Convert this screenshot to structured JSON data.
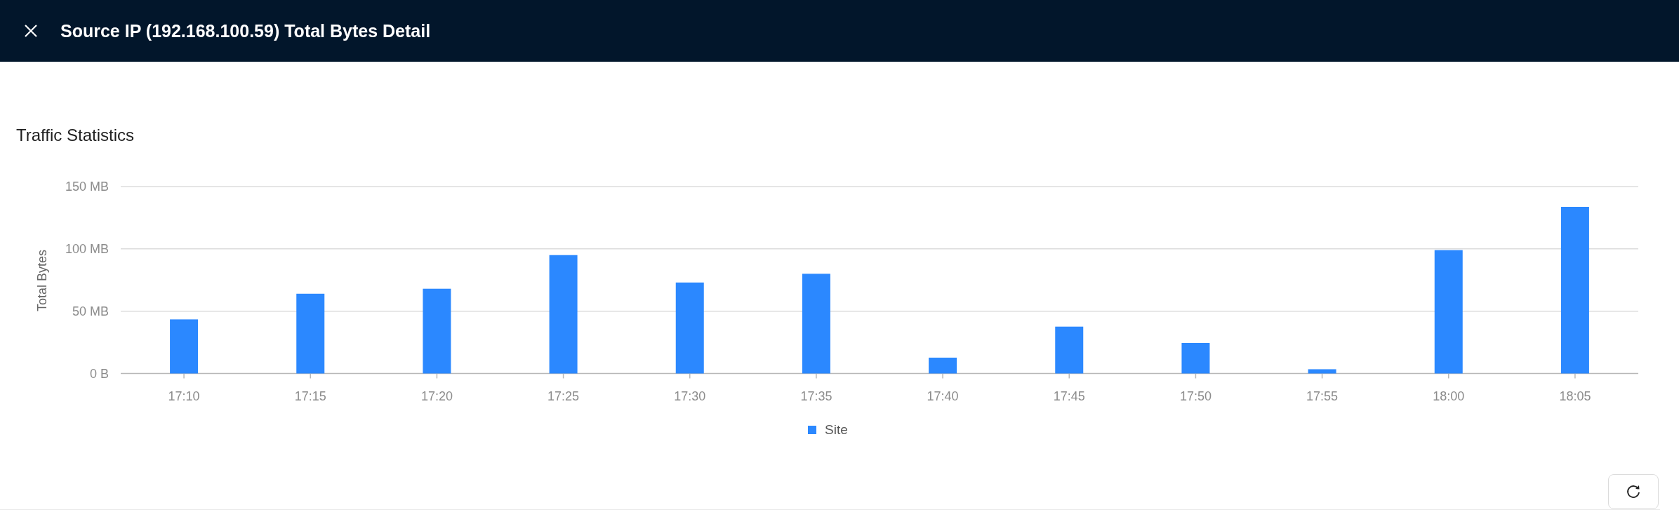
{
  "header": {
    "title": "Source IP (192.168.100.59) Total Bytes Detail"
  },
  "section_title": "Traffic Statistics",
  "chart_data": {
    "type": "bar",
    "ylabel": "Total Bytes",
    "categories": [
      "17:10",
      "17:15",
      "17:20",
      "17:25",
      "17:30",
      "17:35",
      "17:40",
      "17:45",
      "17:50",
      "17:55",
      "18:00",
      "18:05"
    ],
    "series": [
      {
        "name": "Site",
        "color": "#2b88ff",
        "values": [
          43.4,
          64,
          68,
          95,
          73,
          80,
          12.7,
          37.6,
          24.5,
          3.4,
          99,
          133.7
        ]
      }
    ],
    "ylim": [
      0,
      150
    ],
    "yticks": [
      {
        "value": 0,
        "label": "0 B"
      },
      {
        "value": 50,
        "label": "50 MB"
      },
      {
        "value": 100,
        "label": "100 MB"
      },
      {
        "value": 150,
        "label": "150 MB"
      }
    ]
  }
}
